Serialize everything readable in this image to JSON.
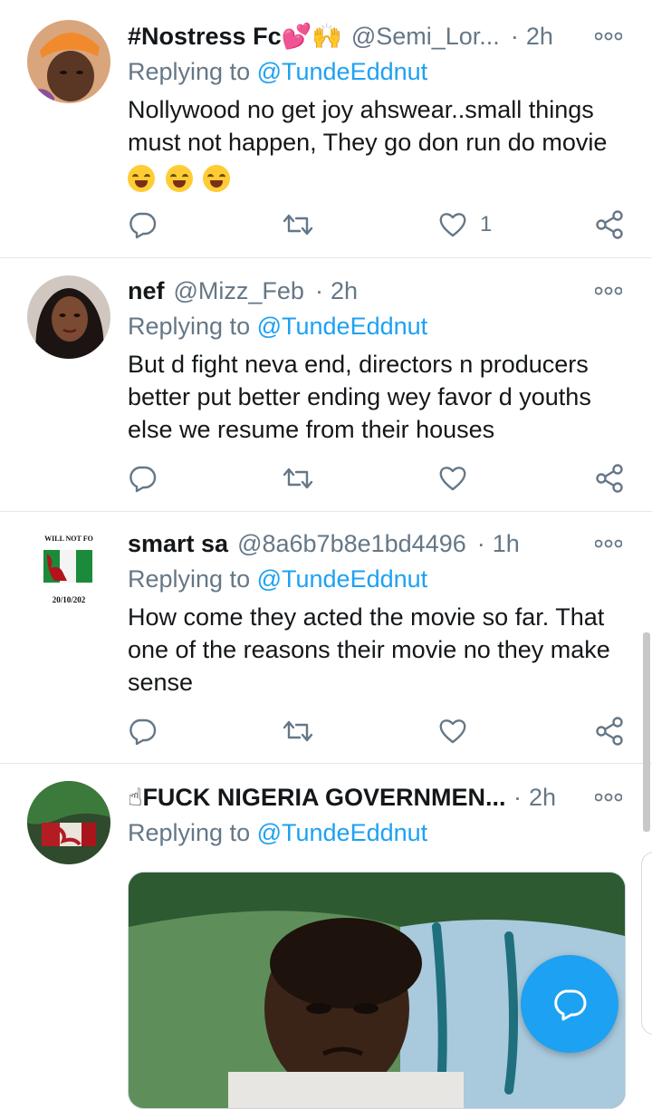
{
  "colors": {
    "accent": "#1da1f2",
    "muted": "#657786",
    "text": "#14171a",
    "divider": "#e1e8ed"
  },
  "tweets": [
    {
      "name": "#Nostress Fc💕🙌",
      "handle": "@Semi_Lor...",
      "time": "2h",
      "replying_prefix": "Replying to",
      "replying_to": "@TundeEddnut",
      "text": "Nollywood no get joy ahswear..small things must not happen, They go don run do movie",
      "emoji": [
        "face-with-tears-of-joy",
        "face-with-tears-of-joy",
        "face-with-tears-of-joy"
      ],
      "likes": "1"
    },
    {
      "name": "nef",
      "handle": "@Mizz_Feb",
      "time": "2h",
      "replying_prefix": "Replying to",
      "replying_to": "@TundeEddnut",
      "text": "But d fight neva end, directors n producers better put better ending wey favor d youths else we resume from their houses"
    },
    {
      "name": "smart sa",
      "handle": "@8a6b7b8e1bd4496",
      "time": "1h",
      "replying_prefix": "Replying to",
      "replying_to": "@TundeEddnut",
      "text": "How come they acted the movie so far. That one of the reasons their movie no they make sense",
      "avatar_text_top": "WILL NOT FO",
      "avatar_text_bottom": "20/10/202"
    },
    {
      "name": "☝FUCK NIGERIA GOVERNMEN...",
      "time": "2h",
      "replying_prefix": "Replying to",
      "replying_to": "@TundeEddnut"
    }
  ],
  "icons": {
    "reply": "reply-icon",
    "retweet": "retweet-icon",
    "like": "heart-icon",
    "share": "share-icon",
    "more": "more-options-icon",
    "compose": "compose-reply-icon"
  }
}
